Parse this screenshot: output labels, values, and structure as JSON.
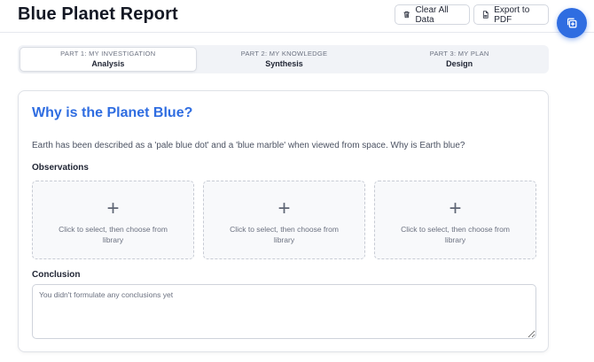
{
  "header": {
    "title": "Blue Planet Report",
    "clear_label": "Clear All Data",
    "export_label": "Export to PDF"
  },
  "tabs": [
    {
      "kicker": "PART 1: MY INVESTIGATION",
      "label": "Analysis",
      "active": true
    },
    {
      "kicker": "PART 2: MY KNOWLEDGE",
      "label": "Synthesis",
      "active": false
    },
    {
      "kicker": "PART 3: MY PLAN",
      "label": "Design",
      "active": false
    }
  ],
  "card": {
    "title": "Why is the Planet Blue?",
    "prompt": "Earth has been described as a 'pale blue dot' and a 'blue marble' when viewed from space. Why is Earth blue?",
    "observations_label": "Observations",
    "slots": [
      {
        "plus": "+",
        "hint": "Click to select, then choose from library"
      },
      {
        "plus": "+",
        "hint": "Click to select, then choose from library"
      },
      {
        "plus": "+",
        "hint": "Click to select, then choose from library"
      }
    ],
    "conclusion_label": "Conclusion",
    "conclusion_value": "",
    "conclusion_placeholder": "You didn't formulate any conclusions yet"
  },
  "icons": {
    "clear": "trash-icon",
    "export": "file-pdf-icon",
    "fab": "copy-icon"
  },
  "colors": {
    "accent": "#2f6de1",
    "title": "#141824",
    "tab_bg": "#f1f3f7"
  }
}
